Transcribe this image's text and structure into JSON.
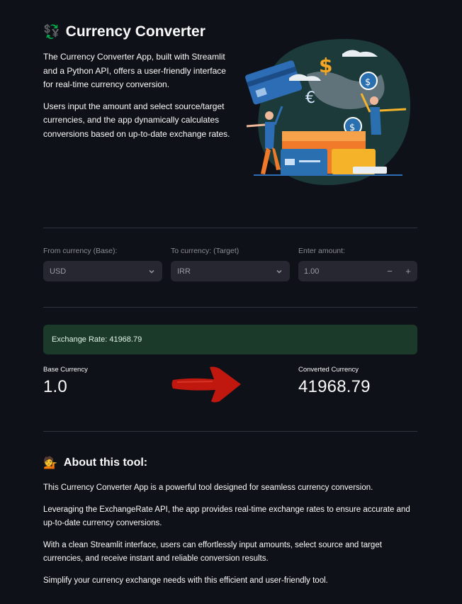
{
  "header": {
    "icon": "currency-exchange-icon",
    "title": "Currency Converter",
    "intro": [
      "The Currency Converter App, built with Streamlit and a Python API, offers a user-friendly interface for real-time currency conversion.",
      "Users input the amount and select source/target currencies, and the app dynamically calculates conversions based on up-to-date exchange rates."
    ]
  },
  "form": {
    "from_label": "From currency (Base):",
    "from_value": "USD",
    "to_label": "To currency: (Target)",
    "to_value": "IRR",
    "amount_label": "Enter amount:",
    "amount_value": "1.00",
    "minus": "−",
    "plus": "+"
  },
  "result": {
    "alert": "Exchange Rate: 41968.79",
    "base_label": "Base Currency",
    "base_value": "1.0",
    "converted_label": "Converted Currency",
    "converted_value": "41968.79"
  },
  "about": {
    "icon": "person-tipping-hand-icon",
    "title": "About this tool:",
    "paragraphs": [
      "This Currency Converter App is a powerful tool designed for seamless currency conversion.",
      "Leveraging the ExchangeRate API, the app provides real-time exchange rates to ensure accurate and up-to-date currency conversions.",
      "With a clean Streamlit interface, users can effortlessly input amounts, select source and target currencies, and receive instant and reliable conversion results.",
      "Simplify your currency exchange needs with this efficient and user-friendly tool."
    ]
  },
  "colors": {
    "background": "#0e1117",
    "input_bg": "#262730",
    "success_bg": "#1c3a2a",
    "arrow": "#c0180f"
  }
}
